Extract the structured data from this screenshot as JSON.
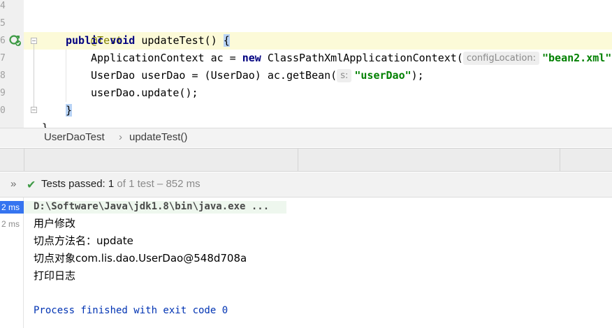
{
  "editor": {
    "line_numbers": [
      "4",
      "5",
      "6",
      "7",
      "8",
      "9",
      "0"
    ],
    "annotation": "@Test",
    "kw_public": "public",
    "kw_void": "void",
    "method_sig": " updateTest() ",
    "open_brace": "{",
    "line_ctx_a": "ApplicationContext ac = ",
    "kw_new": "new",
    "line_ctx_b": " ClassPathXmlApplicationContext(",
    "hint_config": "configLocation:",
    "str_bean": "\"bean2.xml\"",
    "line_dao_a": "UserDao userDao = (UserDao) ac.getBean(",
    "hint_s": "s:",
    "str_userdao": "\"userDao\"",
    "line_dao_end": ");",
    "line_update": "userDao.update();",
    "close_brace": "}",
    "outer_brace": "}"
  },
  "breadcrumb": {
    "class_name": "UserDaoTest",
    "separator": "›",
    "method_name": "updateTest()"
  },
  "test_status": {
    "expand_icon": "»",
    "check_icon": "✔",
    "passed_label": "Tests passed: ",
    "passed_count": "1",
    "detail": " of 1 test – 852 ms"
  },
  "console": {
    "times": [
      "2 ms",
      "2 ms"
    ],
    "command": "D:\\Software\\Java\\jdk1.8\\bin\\java.exe ...",
    "output_lines": [
      "用户修改",
      "切点方法名：update",
      "切点对象com.lis.dao.UserDao@548d708a",
      "打印日志"
    ],
    "exit_line": "Process finished with exit code 0"
  },
  "colors": {
    "keyword": "#000080",
    "annotation": "#808000",
    "string": "#008000",
    "highlight_line": "#fcfad8",
    "selected_time": "#3574f0",
    "success": "#3e9a45",
    "process_finished": "#0033b3"
  }
}
